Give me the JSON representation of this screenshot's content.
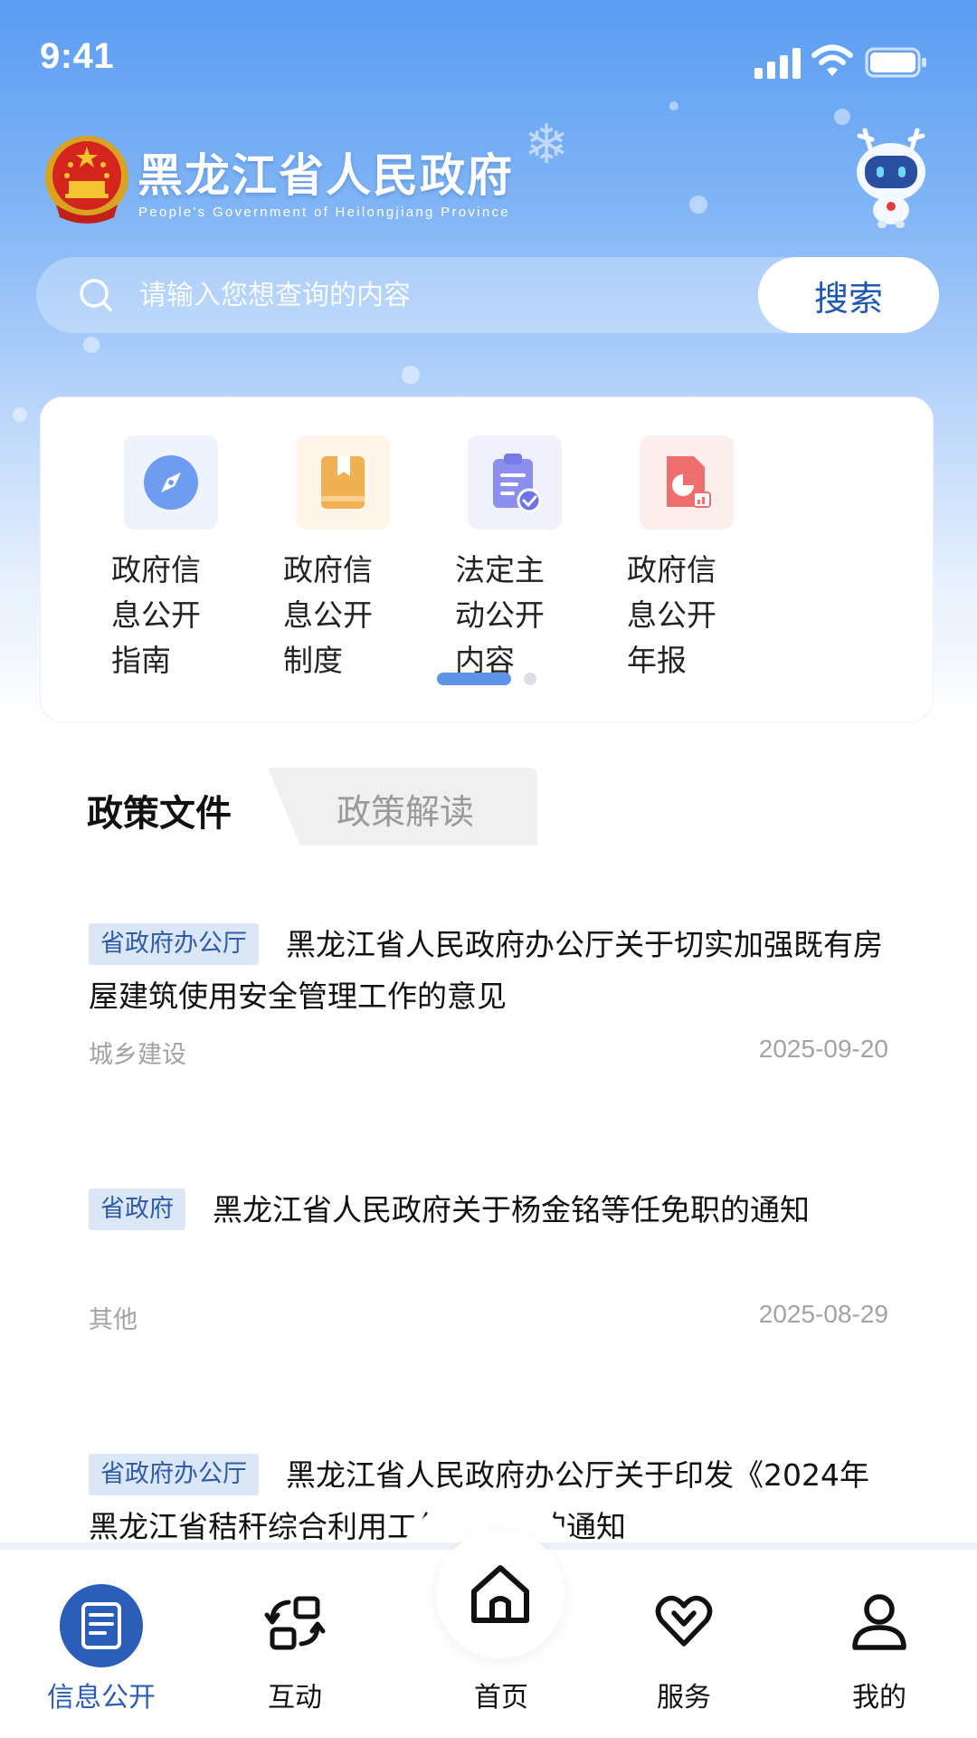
{
  "status_bar": {
    "time": "9:41"
  },
  "header": {
    "title": "黑龙江省人民政府",
    "subtitle": "People's Government of Heilongjiang Province"
  },
  "search": {
    "placeholder": "请输入您想查询的内容",
    "button_label": "搜索"
  },
  "quick_links": [
    {
      "label": "政府信息公开指南",
      "icon": "compass-icon"
    },
    {
      "label": "政府信息公开制度",
      "icon": "book-icon"
    },
    {
      "label": "法定主动公开内容",
      "icon": "clipboard-check-icon"
    },
    {
      "label": "政府信息公开年报",
      "icon": "report-chart-icon"
    }
  ],
  "quick_links_pager": {
    "current_page": 1,
    "total_pages": 2
  },
  "tabs": [
    {
      "label": "政策文件",
      "active": true
    },
    {
      "label": "政策解读",
      "active": false
    }
  ],
  "articles": [
    {
      "tag": "省政府办公厅",
      "title": "黑龙江省人民政府办公厅关于切实加强既有房屋建筑使用安全管理工作的意见",
      "category": "城乡建设",
      "date": "2025-09-20"
    },
    {
      "tag": "省政府",
      "title": "黑龙江省人民政府关于杨金铭等任免职的通知",
      "category": "其他",
      "date": "2025-08-29"
    },
    {
      "tag": "省政府办公厅",
      "title": "黑龙江省人民政府办公厅关于印发《2024年黑龙江省秸秆综合利用工作方案》的通知"
    }
  ],
  "bottom_nav": [
    {
      "label": "信息公开",
      "icon": "document-icon",
      "active": true
    },
    {
      "label": "互动",
      "icon": "interaction-icon",
      "active": false
    },
    {
      "label": "首页",
      "icon": "home-icon",
      "active": false
    },
    {
      "label": "服务",
      "icon": "heart-icon",
      "active": false
    },
    {
      "label": "我的",
      "icon": "user-icon",
      "active": false
    }
  ],
  "colors": {
    "brand_blue": "#2a5eb8",
    "tag_background": "#dbe6f6",
    "tag_text": "#2f5ca6",
    "pager_active": "#5f93e6"
  }
}
